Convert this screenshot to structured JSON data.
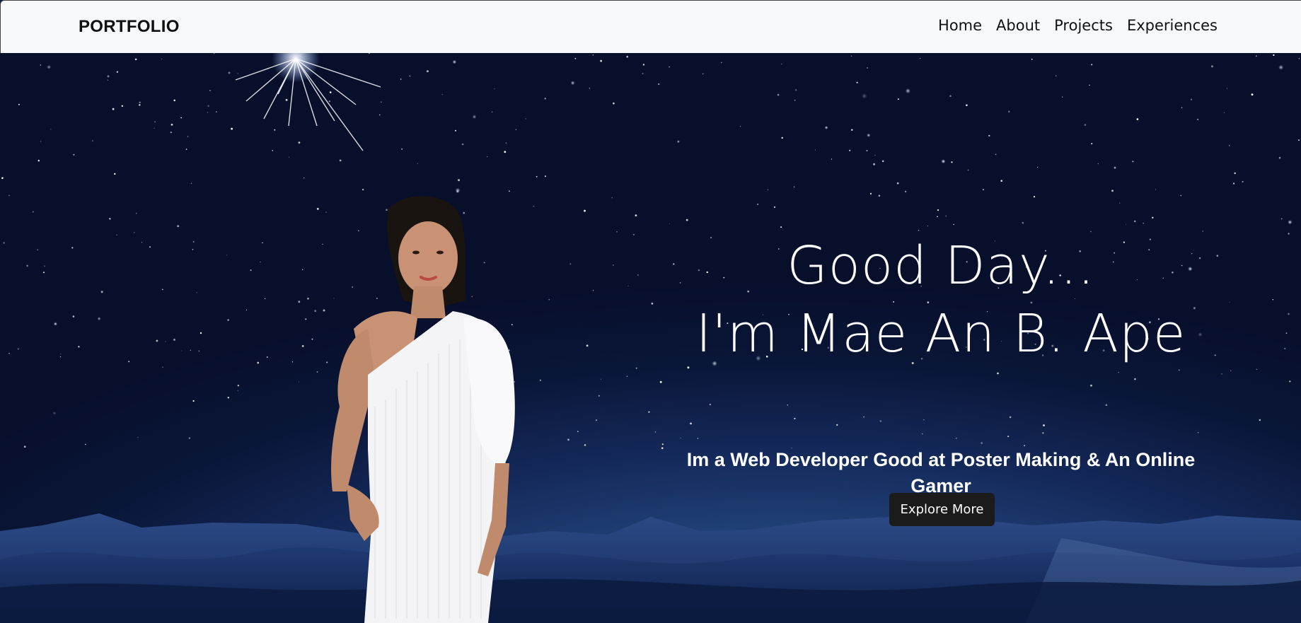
{
  "navbar": {
    "brand": "PORTFOLIO",
    "links": [
      "Home",
      "About",
      "Projects",
      "Experiences"
    ]
  },
  "hero": {
    "greeting": "Good Day...",
    "name_line": "I'm Mae An B. Ape",
    "subtitle": "Im a Web Developer Good at Poster Making & An Online Gamer",
    "cta_label": "Explore More"
  },
  "colors": {
    "navbar_bg": "#f8f9fa",
    "sky_dark": "#070f2b",
    "sky_light": "#3e6aa8",
    "button_bg": "#1b1b1b",
    "text_light": "#ffffff"
  }
}
